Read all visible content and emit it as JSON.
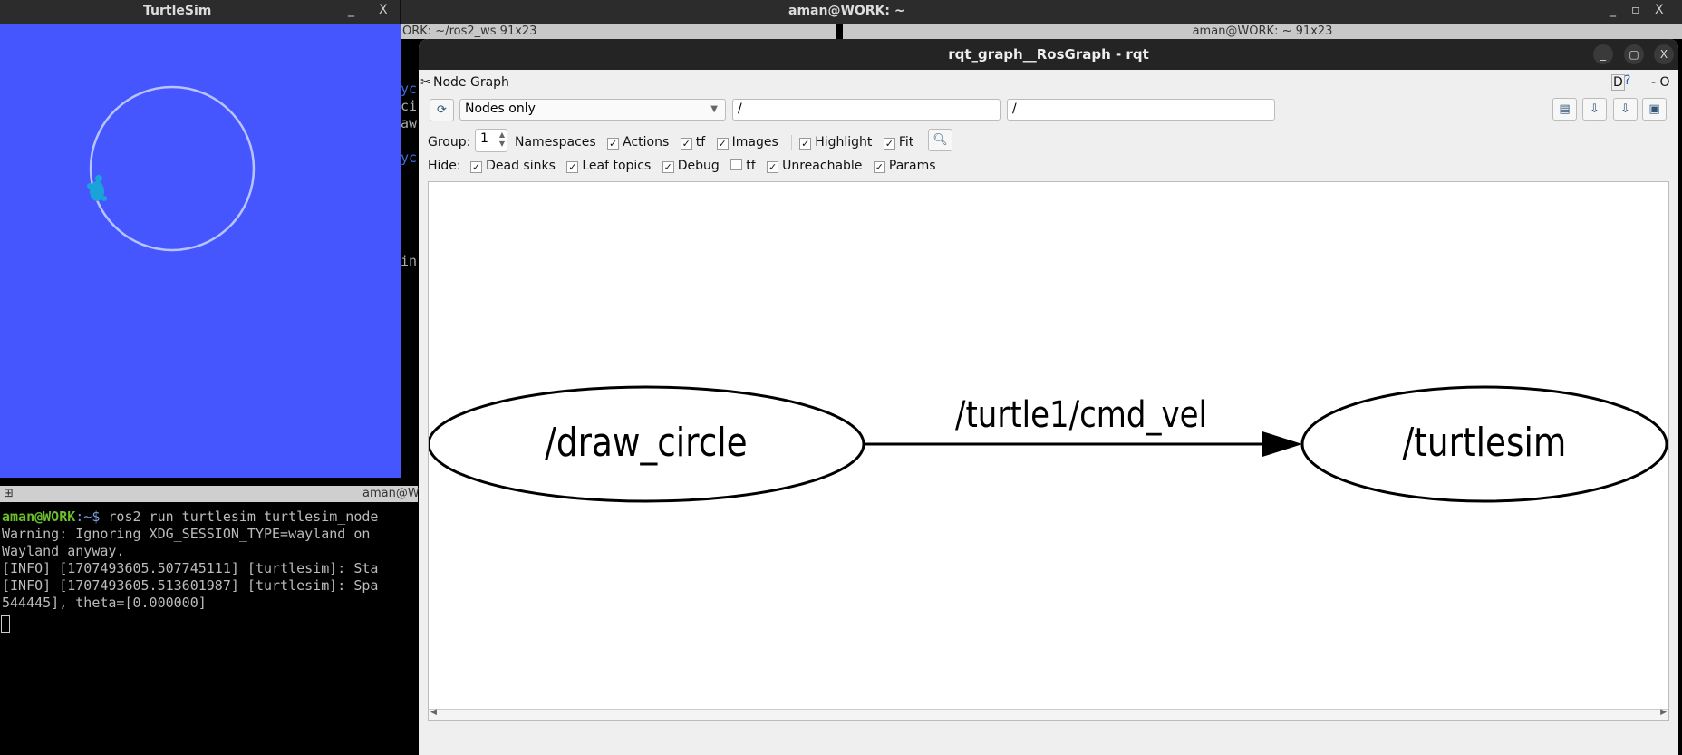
{
  "topbar": {
    "title": "aman@WORK: ~",
    "min": "_",
    "max": "▫",
    "close": "X"
  },
  "turtlesim": {
    "title": "TurtleSim",
    "min": "_",
    "close": "X"
  },
  "bg_terminals": {
    "left_title": "ORK: ~/ros2_ws 91x23",
    "right_title": "aman@WORK: ~ 91x23",
    "lines": [
      "yc",
      "ci",
      "aw",
      "yc",
      "in"
    ]
  },
  "terminal": {
    "title": "aman@W",
    "prompt_user": "aman@WORK",
    "prompt_path": ":~$ ",
    "command": "ros2 run turtlesim turtlesim_node",
    "lines": [
      "Warning: Ignoring XDG_SESSION_TYPE=wayland on",
      "Wayland anyway.",
      "[INFO] [1707493605.507745111] [turtlesim]: Sta",
      "[INFO] [1707493605.513601987] [turtlesim]: Spa",
      "544445], theta=[0.000000]"
    ]
  },
  "rqt": {
    "title": "rqt_graph__RosGraph - rqt",
    "plugin": "Node Graph",
    "corner": "D",
    "corner_help": "?",
    "corner_dash": "- O",
    "mode": "Nodes only",
    "filter1": "/",
    "filter2": "/",
    "group_label": "Group:",
    "group_value": "1",
    "row1": [
      {
        "label": "Namespaces",
        "checked": null
      },
      {
        "label": "Actions",
        "checked": true
      },
      {
        "label": "tf",
        "checked": true
      },
      {
        "label": "Images",
        "checked": true
      },
      {
        "label": "Highlight",
        "checked": true
      },
      {
        "label": "Fit",
        "checked": true
      }
    ],
    "hide_label": "Hide:",
    "row2": [
      {
        "label": "Dead sinks",
        "checked": true
      },
      {
        "label": "Leaf topics",
        "checked": true
      },
      {
        "label": "Debug",
        "checked": true
      },
      {
        "label": "tf",
        "checked": false
      },
      {
        "label": "Unreachable",
        "checked": true
      },
      {
        "label": "Params",
        "checked": true
      }
    ]
  },
  "graph": {
    "nodes": [
      "/draw_circle",
      "/turtlesim"
    ],
    "edge_label": "/turtle1/cmd_vel"
  }
}
